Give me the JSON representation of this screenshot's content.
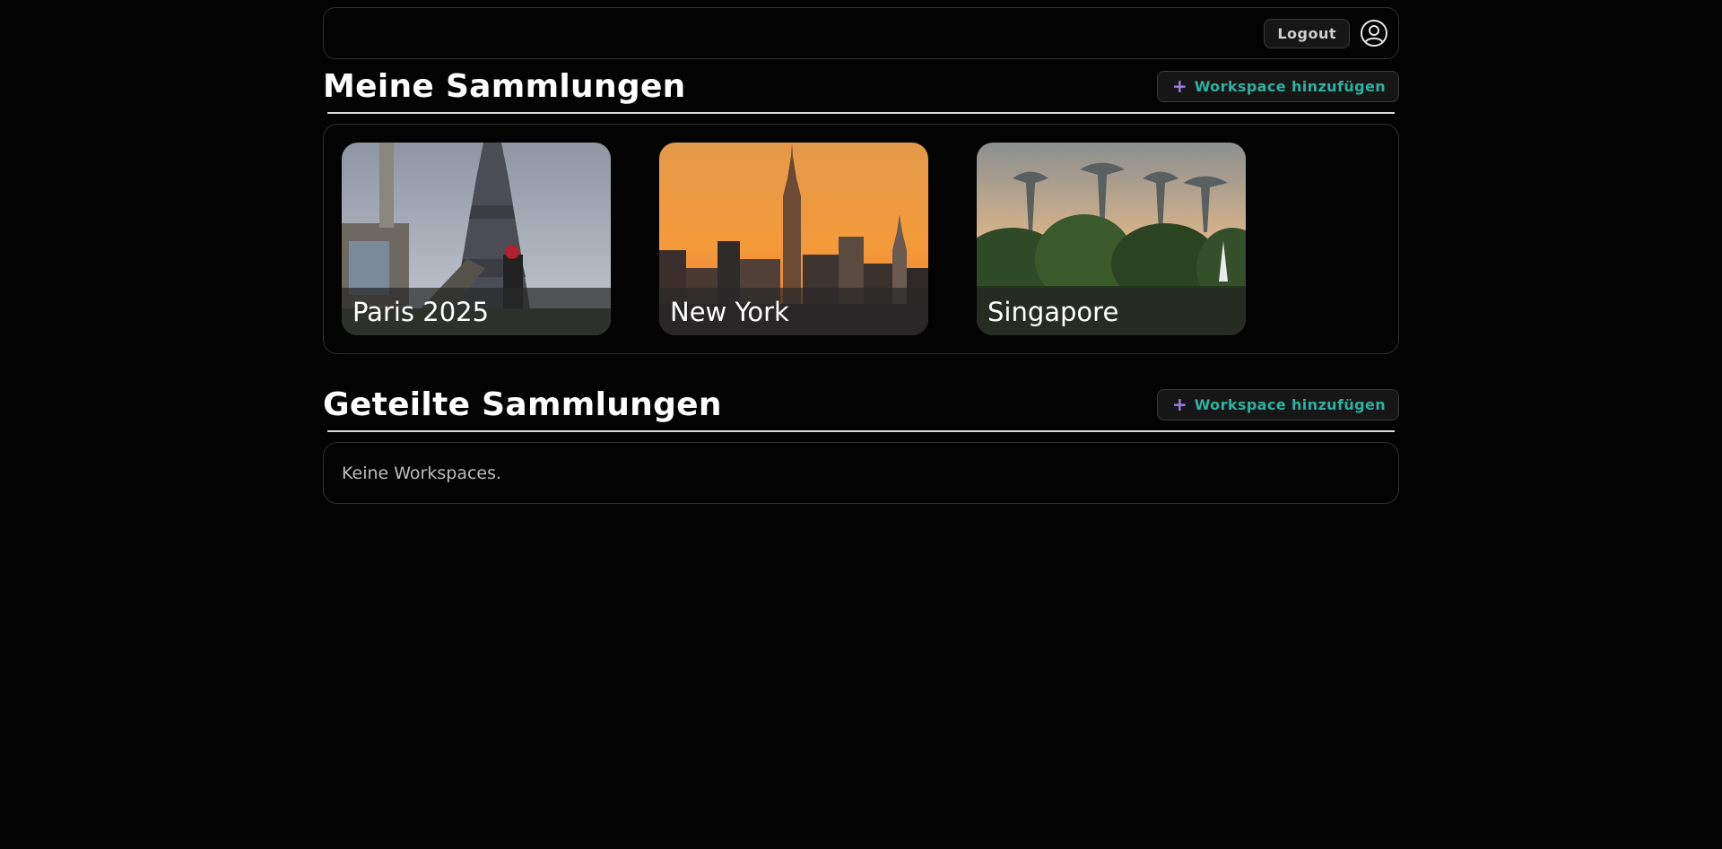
{
  "header": {
    "logout_label": "Logout",
    "avatar_icon": "user-circle-icon"
  },
  "my_collections": {
    "title": "Meine Sammlungen",
    "add_button": {
      "icon": "plus-icon",
      "label": "Workspace hinzufügen"
    },
    "cards": [
      {
        "title": "Paris 2025",
        "image": "eiffel-tower-photo"
      },
      {
        "title": "New York",
        "image": "new-york-skyline-photo"
      },
      {
        "title": "Singapore",
        "image": "singapore-gardens-photo"
      }
    ]
  },
  "shared_collections": {
    "title": "Geteilte Sammlungen",
    "add_button": {
      "icon": "plus-icon",
      "label": "Workspace hinzufügen"
    },
    "empty_text": "Keine Workspaces."
  },
  "colors": {
    "background": "#030303",
    "accent_teal": "#2fb0a0",
    "accent_purple": "#9b7fe8"
  }
}
